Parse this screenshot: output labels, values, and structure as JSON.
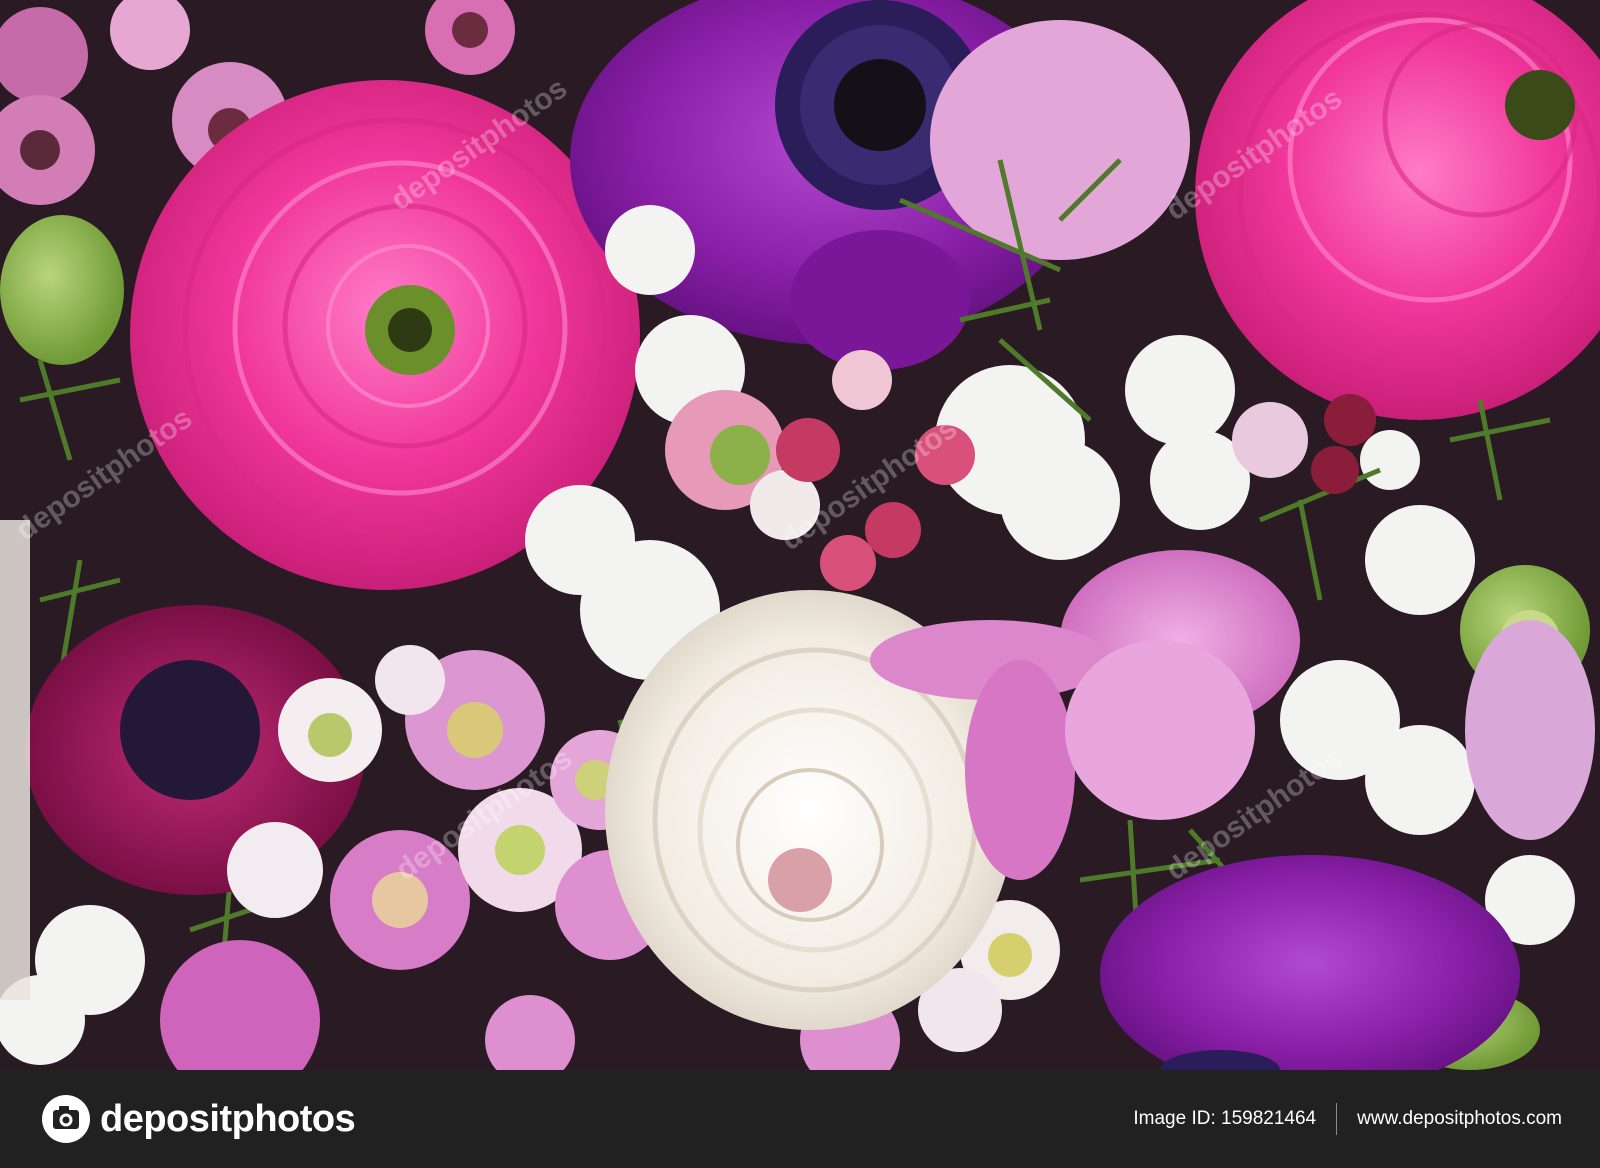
{
  "photo": {
    "subject": "floral-bouquet",
    "colors": {
      "pink_ranunculus": "#f0369a",
      "purple_anemone": "#8a1fa8",
      "white_ranunculus": "#f4efe6",
      "magenta_anemone": "#8e1252",
      "lilac_alstroemeria": "#d979c9",
      "statice_white": "#f2f2f0",
      "greenery": "#4e7a2a",
      "background": "#2a1a24"
    },
    "watermark": "depositphotos"
  },
  "footer": {
    "logo_text": "depositphotos",
    "logo_icon": "camera-icon",
    "image_id": "Image ID: 159821464",
    "site_url": "www.depositphotos.com",
    "background": "#212121"
  }
}
